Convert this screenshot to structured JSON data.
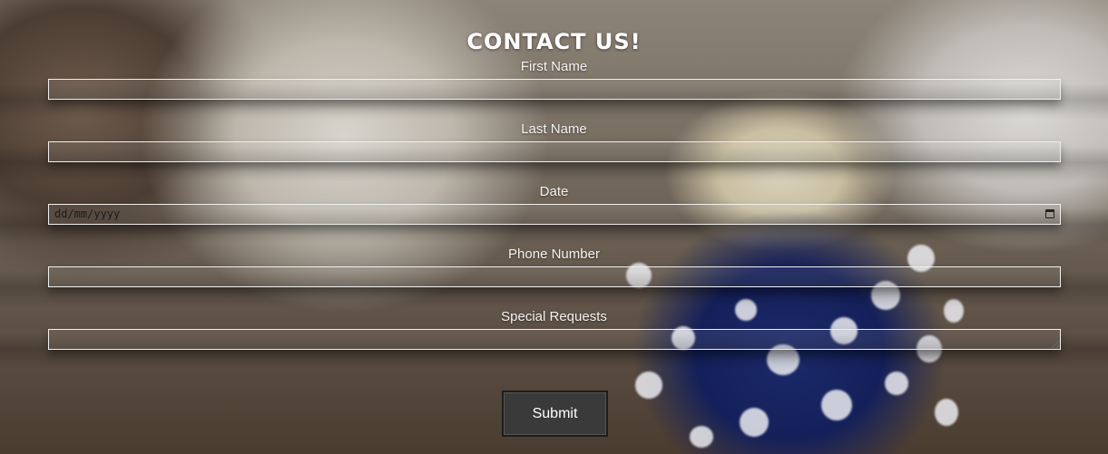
{
  "form": {
    "title": "CONTACT US!",
    "fields": [
      {
        "label": "First Name",
        "value": "",
        "type": "text"
      },
      {
        "label": "Last Name",
        "value": "",
        "type": "text"
      },
      {
        "label": "Date",
        "value": "",
        "placeholder": "dd/mm/yyyy",
        "type": "date"
      },
      {
        "label": "Phone Number",
        "value": "",
        "type": "tel"
      },
      {
        "label": "Special Requests",
        "value": "",
        "type": "textarea"
      }
    ],
    "submit_label": "Submit"
  },
  "colors": {
    "field_border": "#f0f0f0",
    "button_bg": "#3a3a3a",
    "text": "#ffffff"
  },
  "icons": {
    "date_picker": "calendar-icon",
    "textarea_resize": "resize-grip-icon"
  }
}
